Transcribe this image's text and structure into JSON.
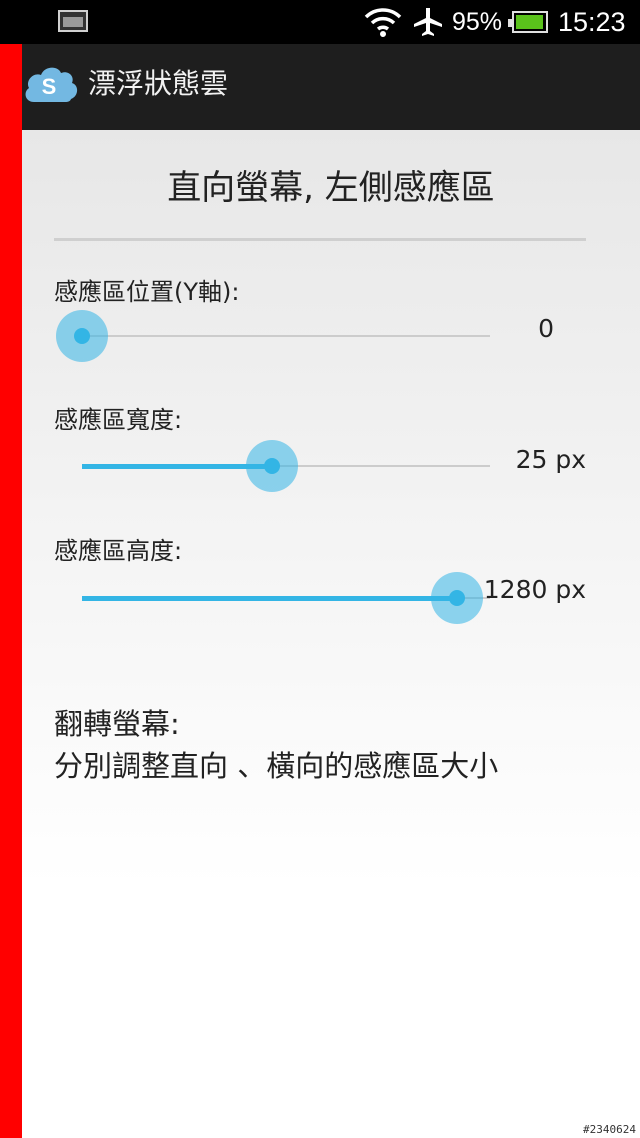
{
  "status_bar": {
    "battery_percent": "95%",
    "battery_level": 0.95,
    "time": "15:23",
    "icons": [
      "notification-icon",
      "wifi-icon",
      "airplane-mode-icon",
      "battery-icon"
    ]
  },
  "action_bar": {
    "app_icon_letter": "S",
    "title": "漂浮狀態雲"
  },
  "page": {
    "title": "直向螢幕, 左側感應區"
  },
  "settings": [
    {
      "label": "感應區位置(Y軸):",
      "value": "0",
      "fraction": 0.0
    },
    {
      "label": "感應區寬度:",
      "value": "25 px",
      "fraction": 0.465
    },
    {
      "label": "感應區高度:",
      "value": "1280 px",
      "fraction": 0.92
    }
  ],
  "note": {
    "line1": "翻轉螢幕:",
    "line2": "分別調整直向 、橫向的感應區大小"
  },
  "colors": {
    "accent": "#33b5e5",
    "edge_strip": "#ff0000",
    "battery": "#5ac21b"
  },
  "watermark": "#2340624"
}
